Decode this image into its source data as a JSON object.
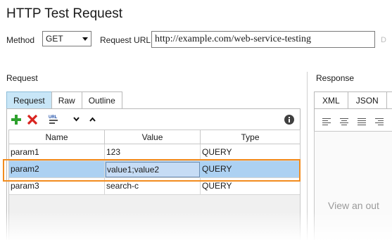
{
  "header": {
    "title": "HTTP Test Request"
  },
  "toolbar": {
    "method_label": "Method",
    "method_value": "GET",
    "url_label": "Request URL:",
    "url_value": "http://example.com/web-service-testing",
    "cut_label": "D"
  },
  "request": {
    "section_title": "Request",
    "tabs": [
      {
        "label": "Request",
        "active": true
      },
      {
        "label": "Raw",
        "active": false
      },
      {
        "label": "Outline",
        "active": false
      }
    ],
    "grid": {
      "columns": [
        "Name",
        "Value",
        "Type"
      ],
      "rows": [
        {
          "name": "param1",
          "value": "123",
          "type": "QUERY",
          "selected": false
        },
        {
          "name": "param2",
          "value": "value1;value2",
          "type": "QUERY",
          "selected": true
        },
        {
          "name": "param3",
          "value": "search-c",
          "type": "QUERY",
          "selected": false
        }
      ]
    }
  },
  "response": {
    "section_title": "Response",
    "tabs": [
      {
        "label": "XML",
        "active": false
      },
      {
        "label": "JSON",
        "active": false
      }
    ],
    "placeholder": "View an out"
  },
  "colors": {
    "highlight": "#f28c1e",
    "selected_row": "#acd1f2",
    "active_tab": "#c8e6f7"
  }
}
